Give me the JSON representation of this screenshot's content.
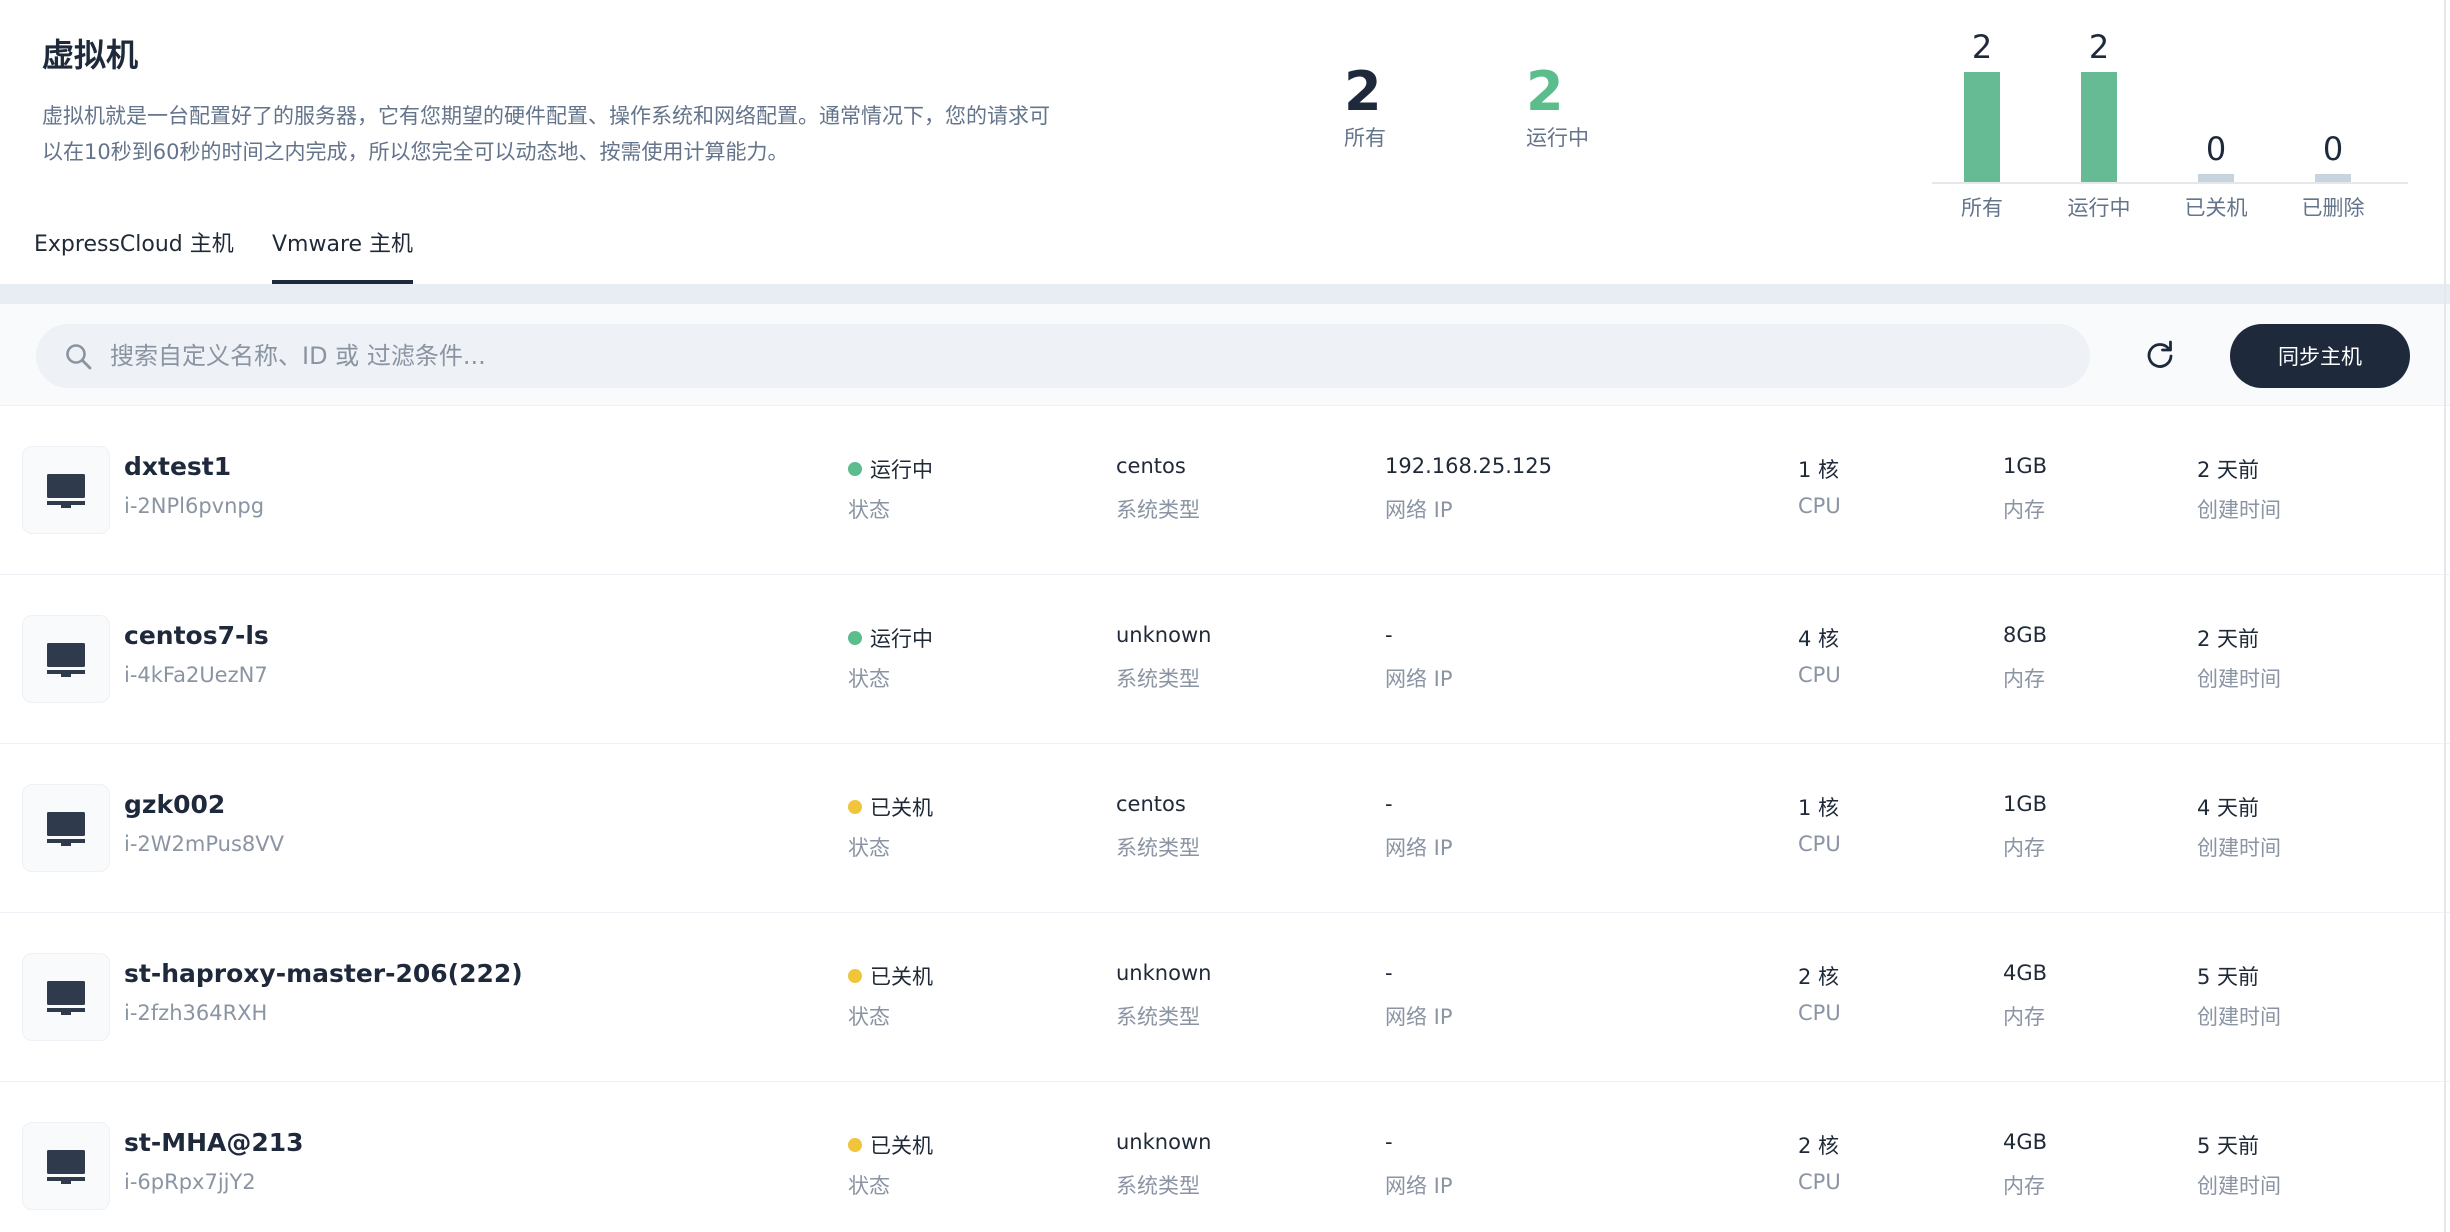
{
  "header": {
    "title": "虚拟机",
    "description": "虚拟机就是一台配置好了的服务器，它有您期望的硬件配置、操作系统和网络配置。通常情况下，您的请求可以在10秒到60秒的时间之内完成，所以您完全可以动态地、按需使用计算能力。"
  },
  "stats": {
    "all": {
      "value": "2",
      "label": "所有"
    },
    "running": {
      "value": "2",
      "label": "运行中"
    }
  },
  "bar_chart": {
    "bars": [
      {
        "label": "所有",
        "value": 2,
        "display": "2",
        "color": "#66bb94"
      },
      {
        "label": "运行中",
        "value": 2,
        "display": "2",
        "color": "#66bb94"
      },
      {
        "label": "已关机",
        "value": 0,
        "display": "0",
        "color": "#c8d3e0"
      },
      {
        "label": "已删除",
        "value": 0,
        "display": "0",
        "color": "#c8d3e0"
      }
    ]
  },
  "tabs": [
    {
      "label": "ExpressCloud 主机",
      "active": false
    },
    {
      "label": "Vmware 主机",
      "active": true
    }
  ],
  "toolbar": {
    "search_placeholder": "搜索自定义名称、ID 或 过滤条件...",
    "sync_label": "同步主机"
  },
  "labels": {
    "status": "状态",
    "os": "系统类型",
    "ip": "网络 IP",
    "cpu": "CPU",
    "memory": "内存",
    "created": "创建时间"
  },
  "status_colors": {
    "running": "#5bbc8c",
    "stopped": "#f0c53a"
  },
  "vms": [
    {
      "name": "dxtest1",
      "id": "i-2NPl6pvnpg",
      "status": "运行中",
      "status_key": "running",
      "os": "centos",
      "ip": "192.168.25.125",
      "cpu": "1 核",
      "memory": "1GB",
      "created": "2 天前"
    },
    {
      "name": "centos7-ls",
      "id": "i-4kFa2UezN7",
      "status": "运行中",
      "status_key": "running",
      "os": "unknown",
      "ip": "-",
      "cpu": "4 核",
      "memory": "8GB",
      "created": "2 天前"
    },
    {
      "name": "gzk002",
      "id": "i-2W2mPus8VV",
      "status": "已关机",
      "status_key": "stopped",
      "os": "centos",
      "ip": "-",
      "cpu": "1 核",
      "memory": "1GB",
      "created": "4 天前"
    },
    {
      "name": "st-haproxy-master-206(222)",
      "id": "i-2fzh364RXH",
      "status": "已关机",
      "status_key": "stopped",
      "os": "unknown",
      "ip": "-",
      "cpu": "2 核",
      "memory": "4GB",
      "created": "5 天前"
    },
    {
      "name": "st-MHA@213",
      "id": "i-6pRpx7jjY2",
      "status": "已关机",
      "status_key": "stopped",
      "os": "unknown",
      "ip": "-",
      "cpu": "2 核",
      "memory": "4GB",
      "created": "5 天前"
    }
  ]
}
